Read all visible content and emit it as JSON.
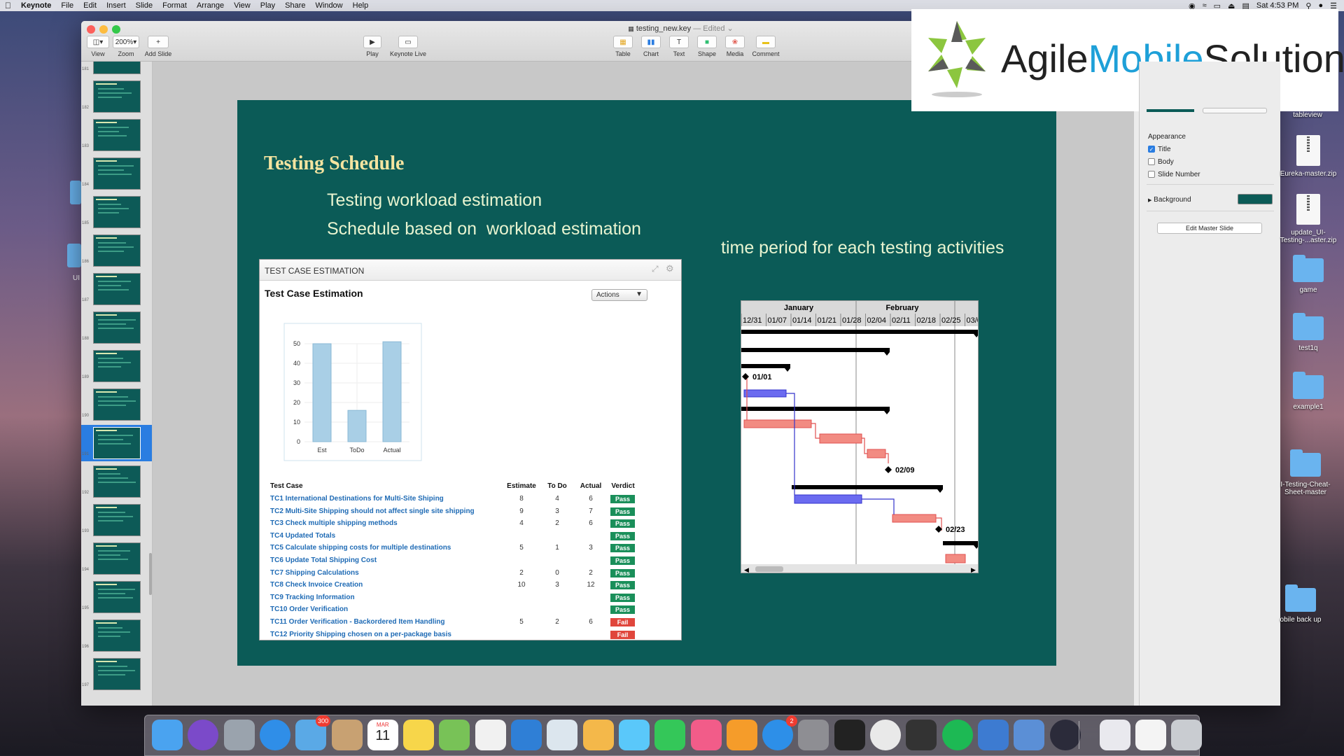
{
  "menubar": {
    "items": [
      "Keynote",
      "File",
      "Edit",
      "Insert",
      "Slide",
      "Format",
      "Arrange",
      "View",
      "Play",
      "Share",
      "Window",
      "Help"
    ],
    "clock": "Sat 4:53 PM"
  },
  "window": {
    "title": "testing_new.key",
    "edited": "— Edited ⌄"
  },
  "toolbar": {
    "view_label": "View",
    "zoom_value": "200%",
    "zoom_label": "Zoom",
    "add_slide_label": "Add Slide",
    "play_label": "Play",
    "keynote_live_label": "Keynote Live",
    "table_label": "Table",
    "chart_label": "Chart",
    "text_label": "Text",
    "shape_label": "Shape",
    "media_label": "Media",
    "comment_label": "Comment"
  },
  "navigator": {
    "numbers": [
      "181",
      "182",
      "183",
      "184",
      "185",
      "186",
      "187",
      "188",
      "189",
      "190",
      "191",
      "192",
      "193",
      "194",
      "195",
      "196",
      "197"
    ]
  },
  "slide": {
    "title": "Testing Schedule",
    "bullet1": "Testing workload estimation",
    "bullet2": "Schedule based on  workload estimation",
    "side_text": "time period for each testing activities"
  },
  "estimation_panel": {
    "header": "TEST CASE ESTIMATION",
    "subtitle": "Test Case Estimation",
    "actions_label": "Actions"
  },
  "chart_data": {
    "type": "bar",
    "categories": [
      "Est",
      "ToDo",
      "Actual"
    ],
    "values": [
      50,
      16,
      51
    ],
    "ylim": [
      0,
      50
    ],
    "yticks": [
      "0",
      "10",
      "20",
      "30",
      "40",
      "50"
    ],
    "color": "#a9cfe6"
  },
  "table": {
    "headers": [
      "Test Case",
      "Estimate",
      "To Do",
      "Actual",
      "Verdict"
    ],
    "rows": [
      {
        "name": "TC1 International Destinations for Multi-Site Shiping",
        "est": "8",
        "todo": "4",
        "actual": "6",
        "verdict": "Pass"
      },
      {
        "name": "TC2 Multi-Site Shipping should not affect single site shipping",
        "est": "9",
        "todo": "3",
        "actual": "7",
        "verdict": "Pass"
      },
      {
        "name": "TC3 Check multiple shipping methods",
        "est": "4",
        "todo": "2",
        "actual": "6",
        "verdict": "Pass"
      },
      {
        "name": "TC4 Updated Totals",
        "est": "",
        "todo": "",
        "actual": "",
        "verdict": "Pass"
      },
      {
        "name": "TC5 Calculate shipping costs for multiple destinations",
        "est": "5",
        "todo": "1",
        "actual": "3",
        "verdict": "Pass"
      },
      {
        "name": "TC6 Update Total Shipping Cost",
        "est": "",
        "todo": "",
        "actual": "",
        "verdict": "Pass"
      },
      {
        "name": "TC7 Shipping Calculations",
        "est": "2",
        "todo": "0",
        "actual": "2",
        "verdict": "Pass"
      },
      {
        "name": "TC8 Check Invoice Creation",
        "est": "10",
        "todo": "3",
        "actual": "12",
        "verdict": "Pass"
      },
      {
        "name": "TC9 Tracking Information",
        "est": "",
        "todo": "",
        "actual": "",
        "verdict": "Pass"
      },
      {
        "name": "TC10 Order Verification",
        "est": "",
        "todo": "",
        "actual": "",
        "verdict": "Pass"
      },
      {
        "name": "TC11 Order Verification - Backordered Item Handling",
        "est": "5",
        "todo": "2",
        "actual": "6",
        "verdict": "Fail"
      },
      {
        "name": "TC12 Priority Shipping chosen on a per-package basis",
        "est": "",
        "todo": "",
        "actual": "",
        "verdict": "Fail"
      }
    ],
    "pass_color": "#1a8f5a",
    "fail_color": "#e0463c"
  },
  "gantt": {
    "months": [
      "January",
      "February"
    ],
    "weeks": [
      "12/31",
      "01/07",
      "01/14",
      "01/21",
      "01/28",
      "02/04",
      "02/11",
      "02/18",
      "02/25",
      "03/0"
    ],
    "milestones": [
      "01/01",
      "02/09",
      "02/23"
    ]
  },
  "inspector": {
    "section": "Appearance",
    "title_label": "Title",
    "body_label": "Body",
    "slide_number_label": "Slide Number",
    "background_label": "Background",
    "background_color": "#0b5b57",
    "edit_master_label": "Edit Master Slide"
  },
  "logo": {
    "text_agile": "Agile",
    "text_mobile": "Mobile",
    "text_solution": "Solution"
  },
  "desktop": {
    "icons": [
      "tableview",
      "Eureka-master.zip",
      "update_UI-Testing-...aster.zip",
      "game",
      "test1q",
      "example1",
      "I-Testing-Cheat-Sheet-master",
      "obile back up"
    ],
    "left_label": "UI"
  },
  "dock": {
    "mail_badge": "300",
    "calendar_month": "MAR",
    "calendar_day": "11",
    "appstore_badge": "2"
  }
}
